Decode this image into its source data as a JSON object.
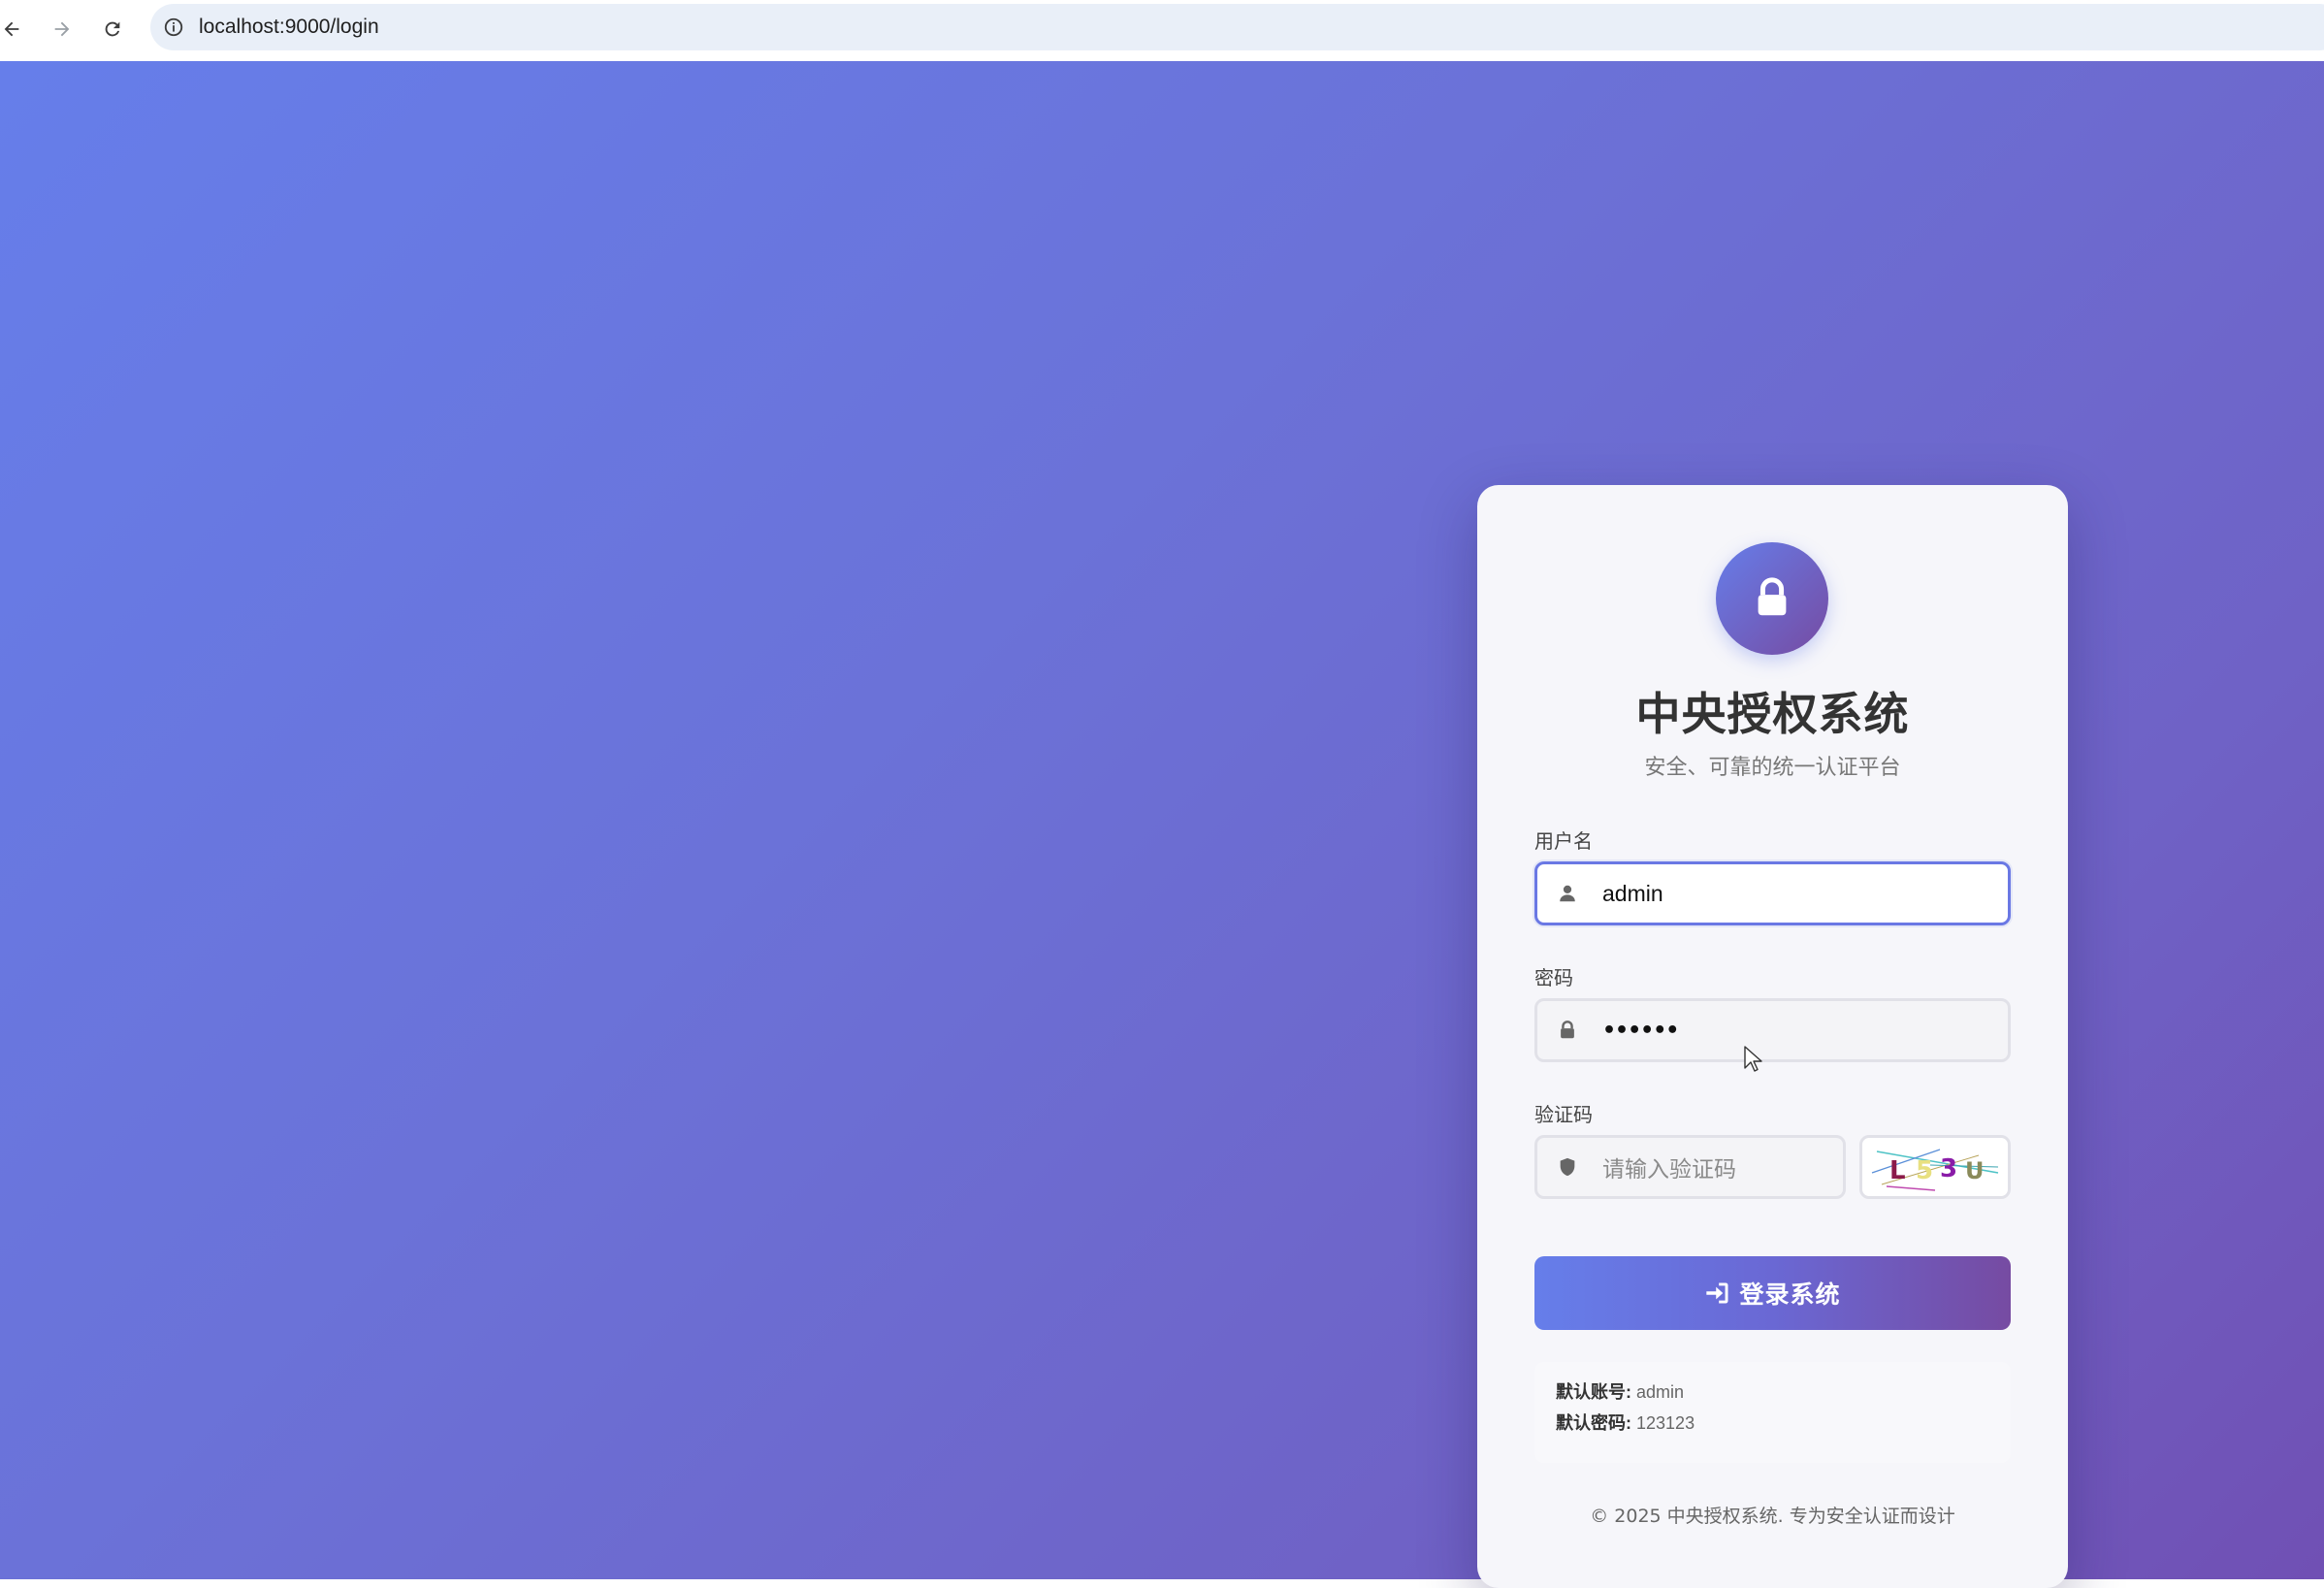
{
  "browser": {
    "url": "localhost:9000/login"
  },
  "login_card": {
    "title": "中央授权系统",
    "subtitle": "安全、可靠的统一认证平台",
    "username": {
      "label": "用户名",
      "value": "admin"
    },
    "password": {
      "label": "密码",
      "value_masked": "••••••"
    },
    "captcha": {
      "label": "验证码",
      "placeholder": "请输入验证码",
      "image_text": "L53U"
    },
    "login_button": {
      "label": "登录系统",
      "icon": "sign-in-icon"
    },
    "hints": {
      "account_label": "默认账号:",
      "account_value": "admin",
      "password_label": "默认密码:",
      "password_value": "123123"
    },
    "footer": "© 2025 中央授权系统. 专为安全认证而设计"
  },
  "colors": {
    "gradient_start": "#667eea",
    "gradient_end": "#764ba2",
    "focus_border": "#6a78e4",
    "title": "#333333"
  },
  "icons": {
    "logo": "lock-icon",
    "username_field": "user-icon",
    "password_field": "lock-icon",
    "captcha_field": "shield-icon"
  }
}
